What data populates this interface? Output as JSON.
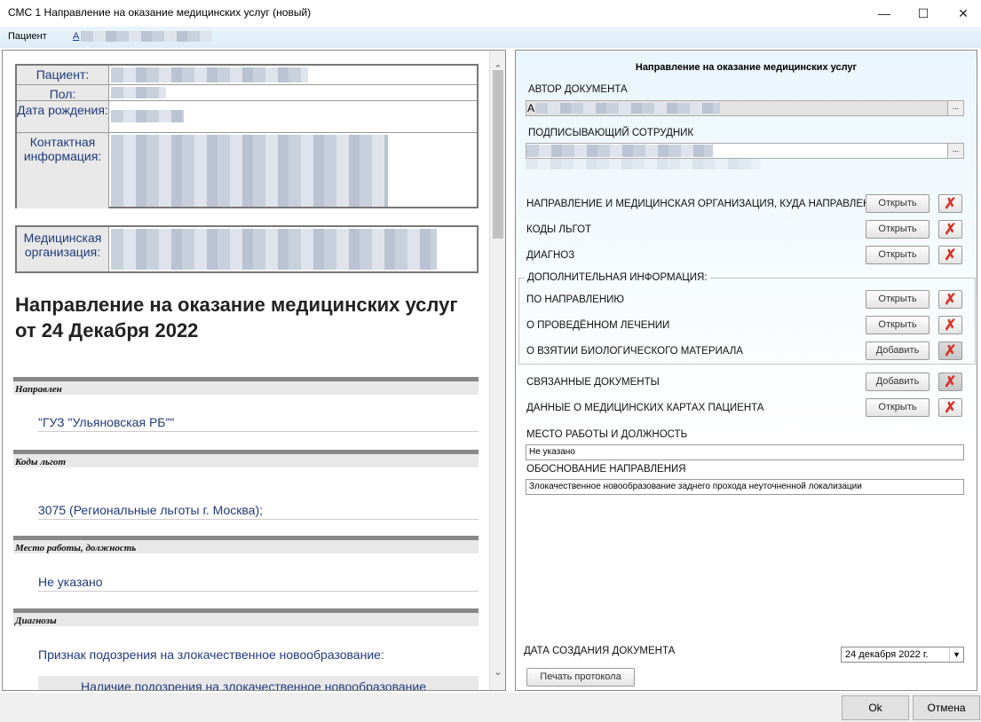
{
  "window": {
    "title": "СМС 1 Направление на оказание медицинских услуг (новый)",
    "minimize": "—",
    "maximize": "☐",
    "close": "✕"
  },
  "menubar": {
    "patient_label": "Пациент",
    "patient_link": "A"
  },
  "left": {
    "info": {
      "patient_label": "Пациент:",
      "gender_label": "Пол:",
      "birth_label": "Дата рождения:",
      "contact_label": "Контактная информация:",
      "org_label": "Медицинская организация:"
    },
    "doc_title": "Направление на оказание медицинских услуг от 24 Декабря 2022",
    "sections": [
      {
        "heading": "Направлен",
        "value": "\"ГУЗ \"Ульяновская РБ\"\""
      },
      {
        "heading": "Коды льгот",
        "value": "3075 (Региональные льготы г. Москва);"
      },
      {
        "heading": "Место работы, должность",
        "value": "Не указано"
      },
      {
        "heading": "Диагнозы",
        "value": "Признак подозрения на злокачественное новообразование:"
      }
    ],
    "diag_sub": "Наличие подозрения на злокачественное новообразование"
  },
  "right": {
    "title": "Направление на оказание медицинских услуг",
    "author_label": "АВТОР ДОКУМЕНТА",
    "author_value": "А",
    "signer_label": "ПОДПИСЫВАЮЩИЙ СОТРУДНИК",
    "ellipsis": "...",
    "rows": [
      {
        "label": "НАПРАВЛЕНИЕ И МЕДИЦИНСКАЯ ОРГАНИЗАЦИЯ, КУДА НАПРАВЛЕН",
        "button": "Открыть"
      },
      {
        "label": "КОДЫ ЛЬГОТ",
        "button": "Открыть"
      },
      {
        "label": "ДИАГНОЗ",
        "button": "Открыть"
      },
      {
        "label": "ПО НАПРАВЛЕНИЮ",
        "button": "Открыть"
      },
      {
        "label": "О ПРОВЕДЁННОМ ЛЕЧЕНИИ",
        "button": "Открыть"
      },
      {
        "label": "О ВЗЯТИИ БИОЛОГИЧЕСКОГО МАТЕРИАЛА",
        "button": "Добавить"
      },
      {
        "label": "СВЯЗАННЫЕ ДОКУМЕНТЫ",
        "button": "Добавить"
      },
      {
        "label": "ДАННЫЕ О МЕДИЦИНСКИХ КАРТАХ ПАЦИЕНТА",
        "button": "Открыть"
      }
    ],
    "extra_group_label": "ДОПОЛНИТЕЛЬНАЯ ИНФОРМАЦИЯ:",
    "work_label": "МЕСТО РАБОТЫ И ДОЛЖНОСТЬ",
    "work_value": "Не указано",
    "reason_label": "ОБОСНОВАНИЕ НАПРАВЛЕНИЯ",
    "reason_value": "Злокачественное новообразование заднего прохода неуточненной локализации",
    "date_label": "ДАТА СОЗДАНИЯ ДОКУМЕНТА",
    "date_value": "24 декабря  2022 г.",
    "print_button": "Печать протокола"
  },
  "dialog": {
    "ok": "Ok",
    "cancel": "Отмена"
  },
  "colors": {
    "accent_link": "#1a3d8f",
    "delete_red": "#d8332a"
  }
}
